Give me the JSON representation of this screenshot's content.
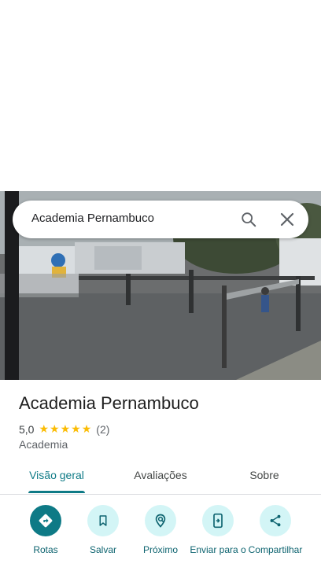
{
  "search": {
    "query": "Academia Pernambuco",
    "search_icon": "search-icon",
    "close_icon": "close-icon"
  },
  "place": {
    "title": "Academia Pernambuco",
    "rating": "5,0",
    "stars": 5,
    "review_count": "(2)",
    "category": "Academia"
  },
  "tabs": [
    {
      "label": "Visão geral",
      "active": true
    },
    {
      "label": "Avaliações",
      "active": false
    },
    {
      "label": "Sobre",
      "active": false
    }
  ],
  "actions": [
    {
      "label": "Rotas",
      "icon": "directions-icon"
    },
    {
      "label": "Salvar",
      "icon": "bookmark-icon"
    },
    {
      "label": "Próximo",
      "icon": "nearby-icon"
    },
    {
      "label": "Enviar para o",
      "icon": "send-to-phone-icon"
    },
    {
      "label": "Compartilhar",
      "icon": "share-icon"
    }
  ],
  "colors": {
    "accent": "#0e7a86",
    "action_bg": "#d3f5f6",
    "star": "#fbbc04"
  }
}
